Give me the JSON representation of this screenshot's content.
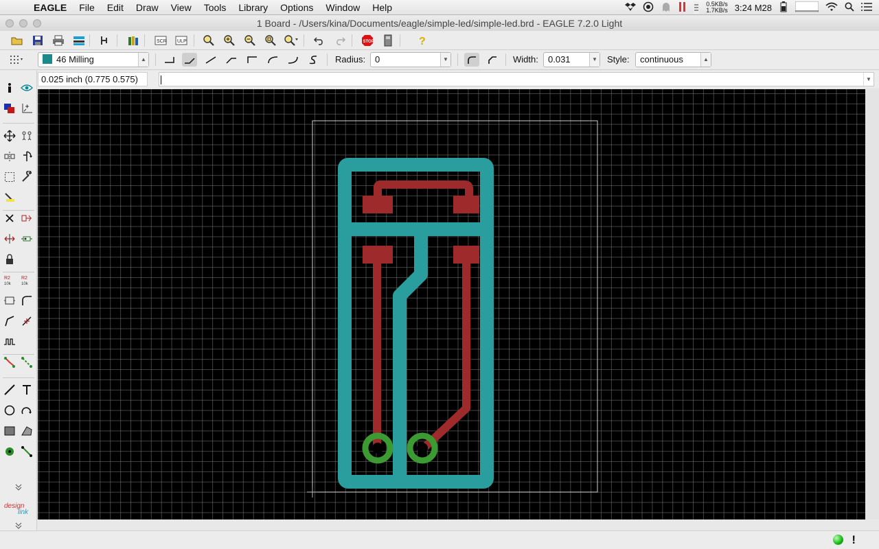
{
  "menubar": {
    "app": "EAGLE",
    "items": [
      "File",
      "Edit",
      "Draw",
      "View",
      "Tools",
      "Library",
      "Options",
      "Window",
      "Help"
    ],
    "net_up": "0.5KB/s",
    "net_down": "1.7KB/s",
    "clock": "3:24 M28"
  },
  "window": {
    "title": "1 Board - /Users/kina/Documents/eagle/simple-led/simple-led.brd - EAGLE 7.2.0 Light"
  },
  "toolbar2": {
    "layer": "46 Milling",
    "layer_color": "#1a8a8a",
    "radius_label": "Radius:",
    "radius_value": "0",
    "width_label": "Width:",
    "width_value": "0.031",
    "style_label": "Style:",
    "style_value": "continuous"
  },
  "cmdrow": {
    "coordinates": "0.025 inch (0.775 0.575)",
    "command": ""
  },
  "palette": {
    "logo_top": "design",
    "logo_bottom": "link"
  },
  "board": {
    "milling_color": "#2a9d9f",
    "copper_color": "#9e2a2b",
    "pad_ring_color": "#3c9a32",
    "outline_color": "#d0d0d0"
  },
  "status": {
    "bang": "!"
  }
}
